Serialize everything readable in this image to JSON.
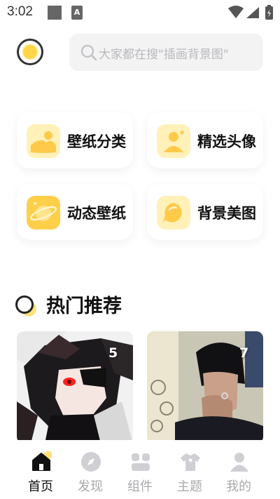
{
  "status_bar": {
    "time": "3:02",
    "notification_icons": [
      "square-icon",
      "a-icon"
    ],
    "system_icons": [
      "wifi-icon",
      "signal-icon",
      "battery-charging-icon"
    ]
  },
  "header": {
    "avatar_icon": "yellow-circle-avatar",
    "search": {
      "placeholder": "大家都在搜\"插画背景图\""
    }
  },
  "categories": [
    {
      "label": "壁纸分类",
      "icon": "landscape-icon"
    },
    {
      "label": "精选头像",
      "icon": "person-icon"
    },
    {
      "label": "动态壁纸",
      "icon": "planet-icon"
    },
    {
      "label": "背景美图",
      "icon": "chat-bubble-icon"
    }
  ],
  "hot": {
    "title": "热门推荐",
    "tiles": [
      {
        "count": "5"
      },
      {
        "count": "7"
      }
    ]
  },
  "bottom_nav": {
    "items": [
      {
        "label": "首页",
        "icon": "home-icon",
        "active": true
      },
      {
        "label": "发现",
        "icon": "discover-icon",
        "active": false
      },
      {
        "label": "组件",
        "icon": "widgets-icon",
        "active": false
      },
      {
        "label": "主题",
        "icon": "shirt-icon",
        "active": false
      },
      {
        "label": "我的",
        "icon": "profile-icon",
        "active": false
      }
    ]
  },
  "colors": {
    "accent": "#ffd54a",
    "accent_light": "#fff1b8",
    "nav_inactive": "#a9a9ad",
    "search_bg": "#f3f3f4"
  }
}
